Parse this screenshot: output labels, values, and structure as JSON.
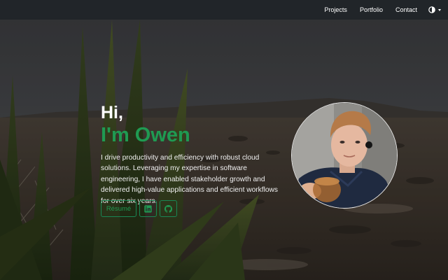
{
  "nav": {
    "links": [
      "Projects",
      "Portfolio",
      "Contact"
    ],
    "theme_toggle_icon": "half-circle-icon"
  },
  "hero": {
    "greeting": "Hi,",
    "name": "I'm Owen",
    "blurb": "I drive productivity and efficiency with robust cloud solutions. Leveraging my expertise in software engineering, I have enabled stakeholder growth and delivered high-value applications and efficient workflows for over six years.",
    "buttons": {
      "resume": "Résumé",
      "linkedin_icon": "linkedin-icon",
      "github_icon": "github-icon"
    }
  },
  "colors": {
    "navbar_bg": "#212529",
    "accent_green": "#198754"
  }
}
